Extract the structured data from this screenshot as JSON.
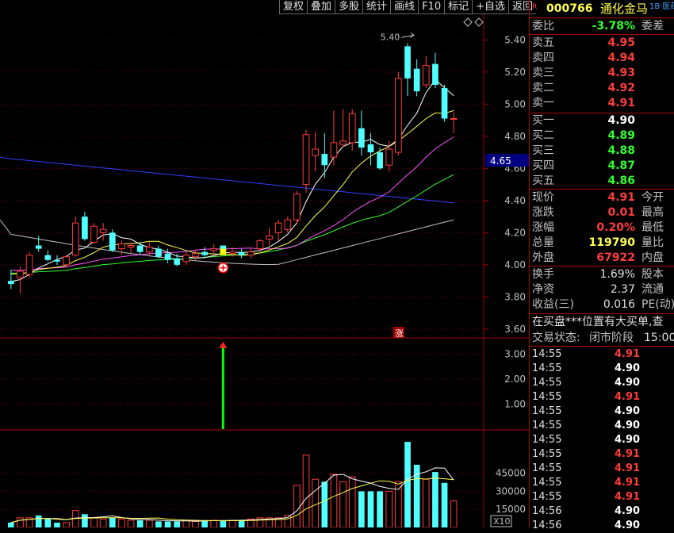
{
  "toolbar": [
    "复权",
    "叠加",
    "多股",
    "统计",
    "画线",
    "F10",
    "标记",
    "+自选",
    "返回"
  ],
  "stock": {
    "marker": "R",
    "code": "000766",
    "name": "通化金马",
    "tag": "1B·医药"
  },
  "quote": {
    "wei_bi_label": "委比",
    "wei_bi": "-3.78%",
    "wei_cha_label": "委差",
    "asks": [
      {
        "label": "卖五",
        "price": "4.95"
      },
      {
        "label": "卖四",
        "price": "4.94"
      },
      {
        "label": "卖三",
        "price": "4.93"
      },
      {
        "label": "卖二",
        "price": "4.92"
      },
      {
        "label": "卖一",
        "price": "4.91"
      }
    ],
    "bids": [
      {
        "label": "买一",
        "price": "4.90"
      },
      {
        "label": "买二",
        "price": "4.89"
      },
      {
        "label": "买三",
        "price": "4.88"
      },
      {
        "label": "买四",
        "price": "4.87"
      },
      {
        "label": "买五",
        "price": "4.86"
      }
    ],
    "stats": [
      {
        "label": "现价",
        "value": "4.91",
        "desc": "今开",
        "color": "red"
      },
      {
        "label": "涨跌",
        "value": "0.01",
        "desc": "最高",
        "color": "red"
      },
      {
        "label": "涨幅",
        "value": "0.20%",
        "desc": "最低",
        "color": "red"
      },
      {
        "label": "总量",
        "value": "119790",
        "desc": "量比",
        "color": "yellow"
      },
      {
        "label": "外盘",
        "value": "67922",
        "desc": "内盘",
        "color": "red"
      }
    ],
    "stats2": [
      {
        "label": "换手",
        "value": "1.69%",
        "desc": "股本"
      },
      {
        "label": "净资",
        "value": "2.37",
        "desc": "流通"
      },
      {
        "label": "收益(三)",
        "value": "0.016",
        "desc": "PE(动)"
      }
    ],
    "alert": "在买盘***位置有大买单,查",
    "status_label": "交易状态:",
    "status": "闭市阶段",
    "status_time": "15:00:"
  },
  "ticks": [
    {
      "time": "14:55",
      "price": "4.91",
      "color": "red"
    },
    {
      "time": "14:55",
      "price": "4.90",
      "color": "white"
    },
    {
      "time": "14:55",
      "price": "4.90",
      "color": "white"
    },
    {
      "time": "14:55",
      "price": "4.91",
      "color": "red"
    },
    {
      "time": "14:55",
      "price": "4.90",
      "color": "white"
    },
    {
      "time": "14:55",
      "price": "4.90",
      "color": "white"
    },
    {
      "time": "14:55",
      "price": "4.90",
      "color": "white"
    },
    {
      "time": "14:55",
      "price": "4.91",
      "color": "red"
    },
    {
      "time": "14:55",
      "price": "4.91",
      "color": "red"
    },
    {
      "time": "14:55",
      "price": "4.91",
      "color": "red"
    },
    {
      "time": "14:55",
      "price": "4.91",
      "color": "red"
    },
    {
      "time": "14:56",
      "price": "4.90",
      "color": "white"
    },
    {
      "time": "14:56",
      "price": "4.90",
      "color": "white"
    }
  ],
  "price_axis": {
    "labels": [
      "5.40",
      "5.20",
      "5.00",
      "4.80",
      "4.60",
      "4.40",
      "4.20",
      "4.00",
      "3.80",
      "3.60"
    ],
    "values": [
      5.4,
      5.2,
      5.0,
      4.8,
      4.6,
      4.4,
      4.2,
      4.0,
      3.8,
      3.6
    ],
    "current": "4.65",
    "high_label": "5.40",
    "zhang_mark": "涨"
  },
  "indicator_axis": {
    "labels": [
      "3.00",
      "2.00",
      "1.00"
    ],
    "values": [
      3,
      2,
      1
    ]
  },
  "volume_axis": {
    "labels": [
      "45000",
      "30000",
      "15000"
    ],
    "values": [
      45000,
      30000,
      15000
    ],
    "unit": "X10"
  },
  "colors": {
    "up": "#ff3c3c",
    "down": "#50ffff",
    "ma5": "#ffffff",
    "ma10": "#ffff50",
    "ma20": "#ff50ff",
    "ma30": "#30ff30",
    "ma60": "#c0c0c0",
    "ma120": "#3040ff",
    "frame": "#a00000"
  },
  "chart_data": {
    "type": "candlestick",
    "candles": [
      {
        "o": 3.9,
        "h": 3.97,
        "l": 3.85,
        "c": 3.88
      },
      {
        "o": 3.92,
        "h": 3.99,
        "l": 3.82,
        "c": 3.96
      },
      {
        "o": 3.94,
        "h": 4.08,
        "l": 3.92,
        "c": 4.06
      },
      {
        "o": 4.12,
        "h": 4.18,
        "l": 4.08,
        "c": 4.1
      },
      {
        "o": 4.06,
        "h": 4.09,
        "l": 4.02,
        "c": 4.03
      },
      {
        "o": 4.03,
        "h": 4.06,
        "l": 4.0,
        "c": 4.02
      },
      {
        "o": 4.0,
        "h": 4.06,
        "l": 3.99,
        "c": 4.05
      },
      {
        "o": 4.06,
        "h": 4.3,
        "l": 4.05,
        "c": 4.26
      },
      {
        "o": 4.3,
        "h": 4.33,
        "l": 4.15,
        "c": 4.16
      },
      {
        "o": 4.14,
        "h": 4.26,
        "l": 4.13,
        "c": 4.24
      },
      {
        "o": 4.2,
        "h": 4.26,
        "l": 4.15,
        "c": 4.22
      },
      {
        "o": 4.2,
        "h": 4.22,
        "l": 4.08,
        "c": 4.09
      },
      {
        "o": 4.1,
        "h": 4.15,
        "l": 4.06,
        "c": 4.13
      },
      {
        "o": 4.11,
        "h": 4.14,
        "l": 4.07,
        "c": 4.12
      },
      {
        "o": 4.12,
        "h": 4.14,
        "l": 4.06,
        "c": 4.08
      },
      {
        "o": 4.08,
        "h": 4.14,
        "l": 4.06,
        "c": 4.11
      },
      {
        "o": 4.1,
        "h": 4.12,
        "l": 4.04,
        "c": 4.05
      },
      {
        "o": 4.07,
        "h": 4.1,
        "l": 4.01,
        "c": 4.03
      },
      {
        "o": 4.04,
        "h": 4.07,
        "l": 3.99,
        "c": 4.0
      },
      {
        "o": 4.02,
        "h": 4.08,
        "l": 4.0,
        "c": 4.06
      },
      {
        "o": 4.05,
        "h": 4.09,
        "l": 4.03,
        "c": 4.07
      },
      {
        "o": 4.08,
        "h": 4.11,
        "l": 4.05,
        "c": 4.06
      },
      {
        "o": 4.09,
        "h": 4.13,
        "l": 4.06,
        "c": 4.1
      },
      {
        "o": 4.12,
        "h": 4.12,
        "l": 4.07,
        "c": 4.08
      },
      {
        "o": 4.07,
        "h": 4.11,
        "l": 4.05,
        "c": 4.08
      },
      {
        "o": 4.08,
        "h": 4.1,
        "l": 4.04,
        "c": 4.06
      },
      {
        "o": 4.06,
        "h": 4.1,
        "l": 4.04,
        "c": 4.08
      },
      {
        "o": 4.1,
        "h": 4.16,
        "l": 4.08,
        "c": 4.15
      },
      {
        "o": 4.16,
        "h": 4.23,
        "l": 4.12,
        "c": 4.18
      },
      {
        "o": 4.2,
        "h": 4.28,
        "l": 4.15,
        "c": 4.26
      },
      {
        "o": 4.22,
        "h": 4.3,
        "l": 4.2,
        "c": 4.28
      },
      {
        "o": 4.28,
        "h": 4.46,
        "l": 4.25,
        "c": 4.44
      },
      {
        "o": 4.5,
        "h": 4.84,
        "l": 4.45,
        "c": 4.81
      },
      {
        "o": 4.68,
        "h": 4.83,
        "l": 4.58,
        "c": 4.72
      },
      {
        "o": 4.69,
        "h": 4.82,
        "l": 4.54,
        "c": 4.62
      },
      {
        "o": 4.67,
        "h": 4.96,
        "l": 4.62,
        "c": 4.76
      },
      {
        "o": 4.75,
        "h": 4.97,
        "l": 4.73,
        "c": 4.77
      },
      {
        "o": 4.76,
        "h": 4.97,
        "l": 4.71,
        "c": 4.94
      },
      {
        "o": 4.85,
        "h": 4.96,
        "l": 4.68,
        "c": 4.73
      },
      {
        "o": 4.75,
        "h": 4.82,
        "l": 4.62,
        "c": 4.7
      },
      {
        "o": 4.7,
        "h": 4.73,
        "l": 4.59,
        "c": 4.6
      },
      {
        "o": 4.62,
        "h": 4.77,
        "l": 4.58,
        "c": 4.72
      },
      {
        "o": 4.7,
        "h": 5.2,
        "l": 4.68,
        "c": 5.16
      },
      {
        "o": 5.36,
        "h": 5.38,
        "l": 5.05,
        "c": 5.16
      },
      {
        "o": 5.22,
        "h": 5.28,
        "l": 5.05,
        "c": 5.08
      },
      {
        "o": 5.12,
        "h": 5.3,
        "l": 5.1,
        "c": 5.24
      },
      {
        "o": 5.25,
        "h": 5.32,
        "l": 5.1,
        "c": 5.12
      },
      {
        "o": 5.1,
        "h": 5.12,
        "l": 4.89,
        "c": 4.91
      },
      {
        "o": 4.91,
        "h": 4.95,
        "l": 4.82,
        "c": 4.91
      }
    ],
    "signal_bar_index": 23,
    "signal_value": 3.5,
    "volumes": [
      4,
      8,
      8,
      10,
      7,
      4,
      4,
      14,
      11,
      8,
      7,
      8,
      7,
      6,
      6,
      6,
      5,
      5,
      5,
      6,
      5,
      6,
      6,
      6,
      6,
      6,
      7,
      8,
      8,
      8,
      10,
      35,
      60,
      40,
      38,
      44,
      38,
      42,
      30,
      30,
      30,
      30,
      38,
      71,
      52,
      40,
      46,
      37,
      22
    ]
  }
}
